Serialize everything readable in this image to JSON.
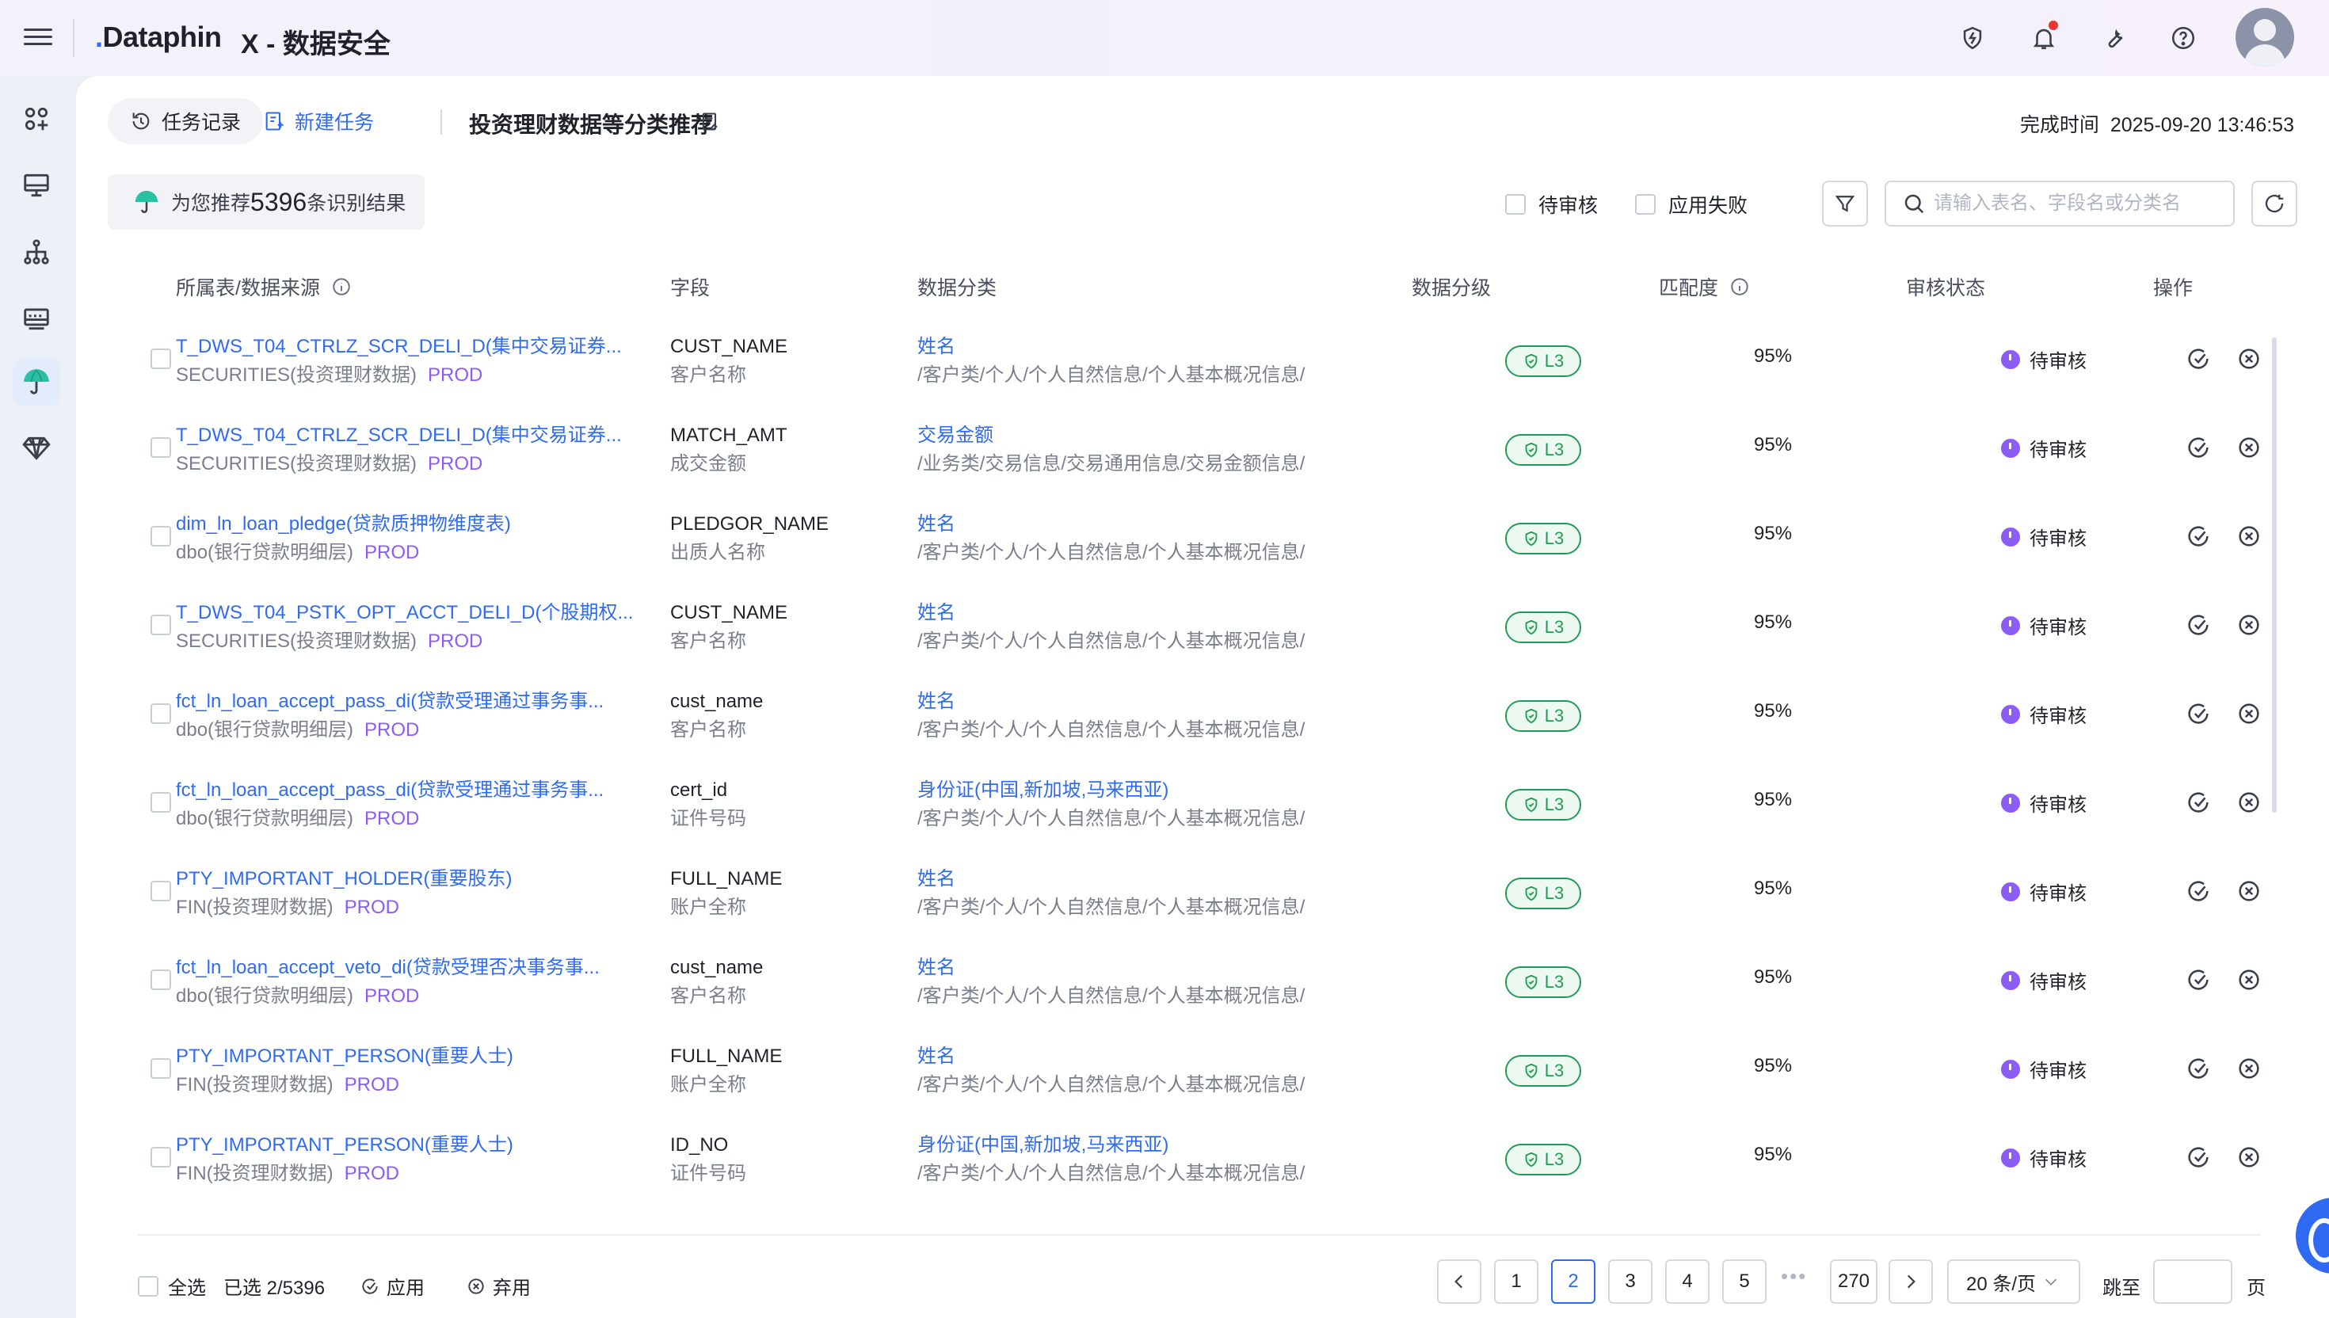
{
  "header": {
    "logo_text": "Dataphin",
    "app_title": "X - 数据安全"
  },
  "icons": {
    "menu": "menu-icon",
    "top": [
      "shield-bolt-icon",
      "bell-icon",
      "wrench-icon",
      "help-icon",
      "avatar"
    ],
    "sidebar": [
      "apps-icon",
      "monitor-icon",
      "hierarchy-icon",
      "server-icon",
      "umbrella-icon",
      "diamond-icon"
    ]
  },
  "tabs": {
    "history_label": "任务记录",
    "new_task_label": "新建任务",
    "task_title": "投资理财数据等分类推荐",
    "finish_label": "完成时间",
    "finish_time": "2025-09-20 13:46:53"
  },
  "recommend": {
    "prefix": "为您推荐",
    "count": "5396",
    "suffix": "条识别结果"
  },
  "filters": {
    "pending_label": "待审核",
    "failed_label": "应用失败",
    "search_placeholder": "请输入表名、字段名或分类名"
  },
  "columns": {
    "table": "所属表/数据来源",
    "field": "字段",
    "category": "数据分类",
    "level": "数据分级",
    "match": "匹配度",
    "status": "审核状态",
    "ops": "操作"
  },
  "rows": [
    {
      "table": "T_DWS_T04_CTRLZ_SCR_DELI_D(集中交易证券...",
      "source": "SECURITIES(投资理财数据)",
      "env": "PROD",
      "field": "CUST_NAME",
      "field_cn": "客户名称",
      "category": "姓名",
      "path": "/客户类/个人/个人自然信息/个人基本概况信息/",
      "level": "L3",
      "match": "95%",
      "status": "待审核"
    },
    {
      "table": "T_DWS_T04_CTRLZ_SCR_DELI_D(集中交易证券...",
      "source": "SECURITIES(投资理财数据)",
      "env": "PROD",
      "field": "MATCH_AMT",
      "field_cn": "成交金额",
      "category": "交易金额",
      "path": "/业务类/交易信息/交易通用信息/交易金额信息/",
      "level": "L3",
      "match": "95%",
      "status": "待审核"
    },
    {
      "table": "dim_ln_loan_pledge(贷款质押物维度表)",
      "source": "dbo(银行贷款明细层)",
      "env": "PROD",
      "field": "PLEDGOR_NAME",
      "field_cn": "出质人名称",
      "category": "姓名",
      "path": "/客户类/个人/个人自然信息/个人基本概况信息/",
      "level": "L3",
      "match": "95%",
      "status": "待审核"
    },
    {
      "table": "T_DWS_T04_PSTK_OPT_ACCT_DELI_D(个股期权...",
      "source": "SECURITIES(投资理财数据)",
      "env": "PROD",
      "field": "CUST_NAME",
      "field_cn": "客户名称",
      "category": "姓名",
      "path": "/客户类/个人/个人自然信息/个人基本概况信息/",
      "level": "L3",
      "match": "95%",
      "status": "待审核"
    },
    {
      "table": "fct_ln_loan_accept_pass_di(贷款受理通过事务事...",
      "source": "dbo(银行贷款明细层)",
      "env": "PROD",
      "field": "cust_name",
      "field_cn": "客户名称",
      "category": "姓名",
      "path": "/客户类/个人/个人自然信息/个人基本概况信息/",
      "level": "L3",
      "match": "95%",
      "status": "待审核"
    },
    {
      "table": "fct_ln_loan_accept_pass_di(贷款受理通过事务事...",
      "source": "dbo(银行贷款明细层)",
      "env": "PROD",
      "field": "cert_id",
      "field_cn": "证件号码",
      "category": "身份证(中国,新加坡,马来西亚)",
      "path": "/客户类/个人/个人自然信息/个人基本概况信息/",
      "level": "L3",
      "match": "95%",
      "status": "待审核"
    },
    {
      "table": "PTY_IMPORTANT_HOLDER(重要股东)",
      "source": "FIN(投资理财数据)",
      "env": "PROD",
      "field": "FULL_NAME",
      "field_cn": "账户全称",
      "category": "姓名",
      "path": "/客户类/个人/个人自然信息/个人基本概况信息/",
      "level": "L3",
      "match": "95%",
      "status": "待审核"
    },
    {
      "table": "fct_ln_loan_accept_veto_di(贷款受理否决事务事...",
      "source": "dbo(银行贷款明细层)",
      "env": "PROD",
      "field": "cust_name",
      "field_cn": "客户名称",
      "category": "姓名",
      "path": "/客户类/个人/个人自然信息/个人基本概况信息/",
      "level": "L3",
      "match": "95%",
      "status": "待审核"
    },
    {
      "table": "PTY_IMPORTANT_PERSON(重要人士)",
      "source": "FIN(投资理财数据)",
      "env": "PROD",
      "field": "FULL_NAME",
      "field_cn": "账户全称",
      "category": "姓名",
      "path": "/客户类/个人/个人自然信息/个人基本概况信息/",
      "level": "L3",
      "match": "95%",
      "status": "待审核"
    },
    {
      "table": "PTY_IMPORTANT_PERSON(重要人士)",
      "source": "FIN(投资理财数据)",
      "env": "PROD",
      "field": "ID_NO",
      "field_cn": "证件号码",
      "category": "身份证(中国,新加坡,马来西亚)",
      "path": "/客户类/个人/个人自然信息/个人基本概况信息/",
      "level": "L3",
      "match": "95%",
      "status": "待审核"
    }
  ],
  "footer": {
    "select_all": "全选",
    "selected": "已选 2/5396",
    "apply": "应用",
    "discard": "弃用",
    "pages": [
      "1",
      "2",
      "3",
      "4",
      "5"
    ],
    "current_page": "2",
    "ellipsis": "•••",
    "last_page": "270",
    "page_size": "20 条/页",
    "jump_label": "跳至",
    "page_unit": "页"
  },
  "colors": {
    "accent": "#2f6bf2",
    "level_tag": "#1f9d55",
    "env_tag": "#8b5cf6",
    "pending_status": "#8b5cf6",
    "notification_dot": "#e8352d"
  }
}
